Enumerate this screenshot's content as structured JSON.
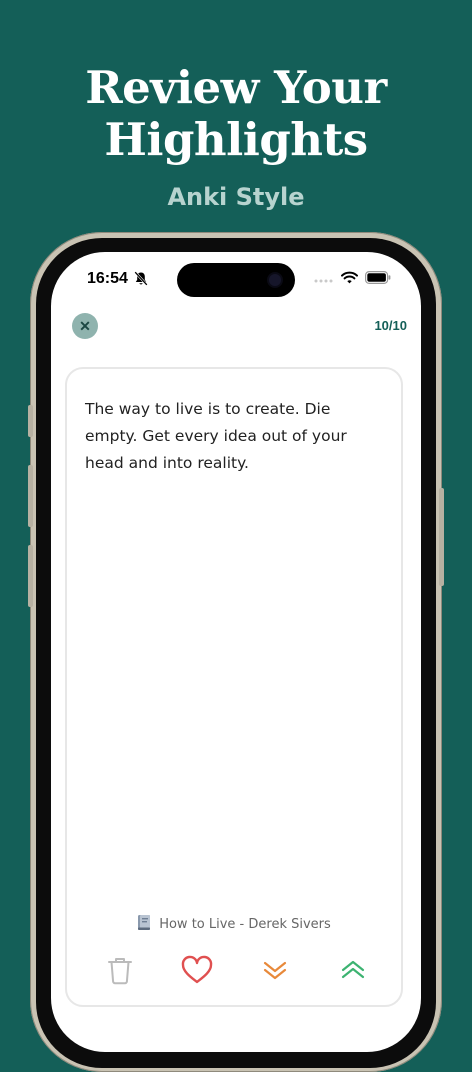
{
  "hero": {
    "title": "Review Your Highlights",
    "subtitle": "Anki Style"
  },
  "status_bar": {
    "time": "16:54",
    "icons": [
      "bell-slash-icon",
      "signal-dots-icon",
      "wifi-icon",
      "battery-icon"
    ]
  },
  "review": {
    "counter": "10/10",
    "quote": "The way to live is to create. Die empty. Get every idea out of your head and into reality.",
    "source": "How to Live - Derek Sivers",
    "actions": [
      "delete",
      "favorite",
      "review-later",
      "review-sooner"
    ]
  },
  "colors": {
    "brand": "#145f58",
    "heart": "#e05050",
    "down": "#e8893a",
    "up": "#3cb371",
    "trash": "#bbbbbb"
  }
}
